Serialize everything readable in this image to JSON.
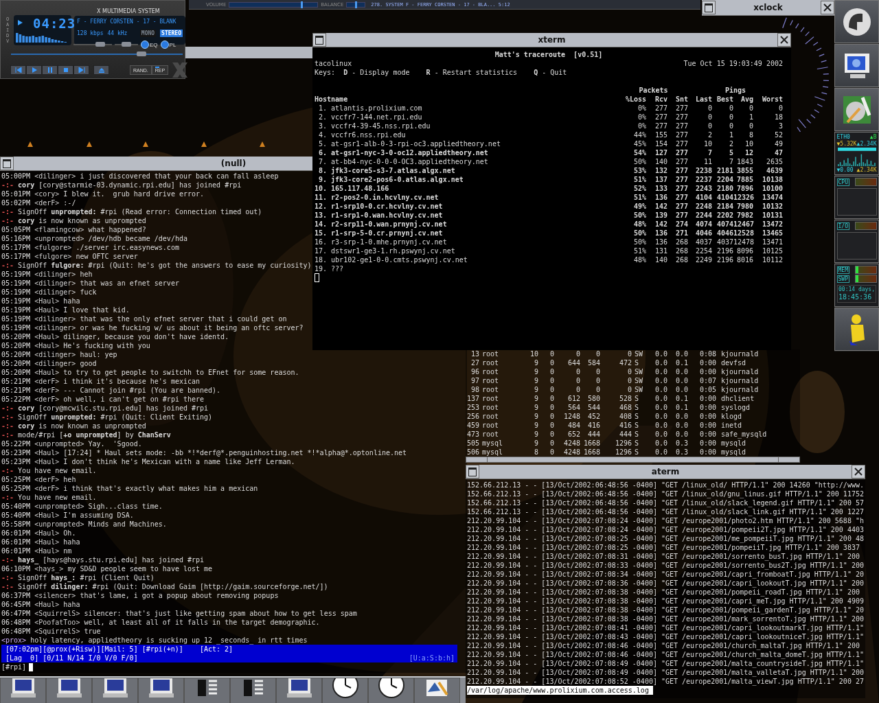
{
  "player": {
    "title": "X MULTIMEDIA SYSTEM",
    "side_letters": "OAIDV",
    "time": "04:23",
    "song": "F - FERRY CORSTEN - 17 - BLANK",
    "bitrate": "128 kbps",
    "samplerate": "44 kHz",
    "channel_modes": [
      {
        "label": "MONO",
        "selected": false
      },
      {
        "label": "STEREO",
        "selected": true
      }
    ],
    "volume": {
      "level": 0.7
    },
    "balance": {
      "level": 0.5
    },
    "position": {
      "level": 0.76
    },
    "toggles": [
      {
        "label": "EQ",
        "on": true
      },
      {
        "label": "PL",
        "on": true
      }
    ],
    "modes": [
      {
        "label": "RAND.",
        "on": false
      },
      {
        "label": "REP",
        "on": true
      }
    ]
  },
  "topbar": {
    "volume": {
      "label": "VOLUME",
      "level": 0.82
    },
    "balance": {
      "label": "BALANCE",
      "level": 0.5
    },
    "track": "278. SYSTEM F - FERRY CORSTEN - 17 - BLA...  5:12"
  },
  "xclock": {
    "title": "xclock"
  },
  "irc": {
    "title": "(null)",
    "lines": [
      {
        "kind": "msg",
        "time": "05:00PM",
        "nick": "<dilinger>",
        "text": "i just discovered that your back can fall asleep"
      },
      {
        "kind": "event",
        "prefix": "-:-",
        "text": "**cory** [cory@starmie-03.dynamic.rpi.edu] has joined #rpi"
      },
      {
        "kind": "msg",
        "time": "05:01PM",
        "nick": "<cory>",
        "text": "I blew it.  grub hard drive error."
      },
      {
        "kind": "msg",
        "time": "05:02PM",
        "nick": "<derF>",
        "text": ":-/"
      },
      {
        "kind": "event",
        "prefix": "-:-",
        "text": "SignOff **unprompted:** #rpi (Read error: Connection timed out)"
      },
      {
        "kind": "event",
        "prefix": "-:-",
        "text": "**cory** is now known as unprompted"
      },
      {
        "kind": "msg",
        "time": "05:05PM",
        "nick": "<flamingcow>",
        "text": "what happened?"
      },
      {
        "kind": "msg",
        "time": "05:16PM",
        "nick": "<unprompted>",
        "text": "/dev/hdb became /dev/hda"
      },
      {
        "kind": "msg",
        "time": "05:17PM",
        "nick": "<fulgore>",
        "text": "./server irc.easynews.com"
      },
      {
        "kind": "msg",
        "time": "05:17PM",
        "nick": "<fulgore>",
        "text": "new OFTC server"
      },
      {
        "kind": "event",
        "prefix": "-:-",
        "text": "SignOff **fulgore:** #rpi (Quit: he's got the answers to ease my curiosity)"
      },
      {
        "kind": "msg",
        "time": "05:19PM",
        "nick": "<dilinger>",
        "text": "heh"
      },
      {
        "kind": "msg",
        "time": "05:19PM",
        "nick": "<dilinger>",
        "text": "that was an efnet server"
      },
      {
        "kind": "msg",
        "time": "05:19PM",
        "nick": "<dilinger>",
        "text": "fuck"
      },
      {
        "kind": "msg",
        "time": "05:19PM",
        "nick": "<Haul>",
        "text": "haha"
      },
      {
        "kind": "msg",
        "time": "05:19PM",
        "nick": "<Haul>",
        "text": "I love that kid."
      },
      {
        "kind": "msg",
        "time": "05:19PM",
        "nick": "<dilinger>",
        "text": "that was the only efnet server that i could get on"
      },
      {
        "kind": "msg",
        "time": "05:19PM",
        "nick": "<dilinger>",
        "text": "or was he fucking w/ us about it being an oftc server?"
      },
      {
        "kind": "msg",
        "time": "05:20PM",
        "nick": "<Haul>",
        "text": "dilinger, because you don't have identd."
      },
      {
        "kind": "msg",
        "time": "05:20PM",
        "nick": "<Haul>",
        "text": "He's fucking with you"
      },
      {
        "kind": "msg",
        "time": "05:20PM",
        "nick": "<dilinger>",
        "text": "haul: yep"
      },
      {
        "kind": "msg",
        "time": "05:20PM",
        "nick": "<dilinger>",
        "text": "good"
      },
      {
        "kind": "msg",
        "time": "05:20PM",
        "nick": "<Haul>",
        "text": "to try to get people to switchh to EFnet for some reason."
      },
      {
        "kind": "msg",
        "time": "05:21PM",
        "nick": "<derF>",
        "text": "i think it's because he's mexican"
      },
      {
        "kind": "msg",
        "time": "05:21PM",
        "nick": "<derF>",
        "text": "--- Cannot join #rpi (You are banned)."
      },
      {
        "kind": "msg",
        "time": "05:22PM",
        "nick": "<derF>",
        "text": "oh well, i can't get on #rpi there"
      },
      {
        "kind": "event",
        "prefix": "-:-",
        "text": "**cory** [cory@mcwilc.stu.rpi.edu] has joined #rpi"
      },
      {
        "kind": "event",
        "prefix": "-:-",
        "text": "SignOff **unprompted:** #rpi (Quit: Client Exiting)"
      },
      {
        "kind": "event",
        "prefix": "-:-",
        "text": "**cory** is now known as unprompted"
      },
      {
        "kind": "event",
        "prefix": "-:-",
        "text": "mode/#rpi [**+o unprompted**] by **ChanServ**"
      },
      {
        "kind": "msg",
        "time": "05:22PM",
        "nick": "<unprompted>",
        "text": "Yay.  'Sgood."
      },
      {
        "kind": "msg",
        "time": "05:23PM",
        "nick": "<Haul>",
        "text": "[17:24] * Haul sets mode: -bb *!*derf@*.penguinhosting.net *!*alpha@*.optonline.net"
      },
      {
        "kind": "msg",
        "time": "05:23PM",
        "nick": "<Haul>",
        "text": "I don't think he's Mexican with a name like Jeff Lerman."
      },
      {
        "kind": "event",
        "prefix": "-:-",
        "text": "You have new email."
      },
      {
        "kind": "msg",
        "time": "05:25PM",
        "nick": "<derF>",
        "text": "heh"
      },
      {
        "kind": "msg",
        "time": "05:25PM",
        "nick": "<derF>",
        "text": "i think that's exactly what makes him a mexican"
      },
      {
        "kind": "event",
        "prefix": "-:-",
        "text": "You have new email."
      },
      {
        "kind": "msg",
        "time": "05:40PM",
        "nick": "<unprompted>",
        "text": "Sigh...class time."
      },
      {
        "kind": "msg",
        "time": "05:40PM",
        "nick": "<Haul>",
        "text": "I'm assuming DSA."
      },
      {
        "kind": "msg",
        "time": "05:58PM",
        "nick": "<unprompted>",
        "text": "Minds and Machines."
      },
      {
        "kind": "msg",
        "time": "06:01PM",
        "nick": "<Haul>",
        "text": "Oh."
      },
      {
        "kind": "msg",
        "time": "06:01PM",
        "nick": "<Haul>",
        "text": "haha"
      },
      {
        "kind": "msg",
        "time": "06:01PM",
        "nick": "<Haul>",
        "text": "nm"
      },
      {
        "kind": "event",
        "prefix": "-:-",
        "text": "**hays_** [hays@hays.stu.rpi.edu] has joined #rpi"
      },
      {
        "kind": "msg",
        "time": "06:10PM",
        "nick": "<hays_>",
        "text": "my SD&D people seem to have lost me"
      },
      {
        "kind": "event",
        "prefix": "-:-",
        "text": "SignOff **hays_:** #rpi (Client Quit)"
      },
      {
        "kind": "event",
        "prefix": "-:-",
        "text": "SignOff **dilinger:** #rpi (Quit: Download Gaim [http://gaim.sourceforge.net/])"
      },
      {
        "kind": "msg",
        "time": "06:37PM",
        "nick": "<silencer>",
        "text": "that's lame, i got a popup about removing popups"
      },
      {
        "kind": "msg",
        "time": "06:45PM",
        "nick": "<Haul>",
        "text": "haha"
      },
      {
        "kind": "msg",
        "time": "06:47PM",
        "nick": "<SquirrelS>",
        "text": "silencer: that's just like getting spam about how to get less spam"
      },
      {
        "kind": "msg",
        "time": "06:48PM",
        "nick": "<PoofatToo>",
        "text": "well, at least all of it falls in the target demographic."
      },
      {
        "kind": "msg",
        "time": "06:48PM",
        "nick": "<SquirrelS>",
        "text": "true"
      },
      {
        "kind": "own",
        "nick": "<prox>",
        "text": "holy latency, appliedtheory is sucking up 12 _seconds_ in rtt times"
      }
    ],
    "status_1": "[07:02pm][@prox(+Risw)][Mail: 5] [#rpi(+n)]    [Act: 2]",
    "status_2": "[Lag  0] [0/11 N/14 I/0 V/0 F/0]",
    "status_2_right": "[U:a:S:b:h]",
    "prompt": "[#rpi]"
  },
  "xterm": {
    "title": "xterm",
    "heading": "Matt's traceroute  [v0.51]",
    "host": "tacolinux",
    "date": "Tue Oct 15 19:03:49 2002",
    "keys": "Keys:  **D** - Display mode    **R** - Restart statistics    **Q** - Quit",
    "groups": [
      "Packets",
      "Pings"
    ],
    "columns": [
      "Hostname",
      "%Loss",
      "Rcv",
      "Snt",
      "Last",
      "Best",
      "Avg",
      "Worst"
    ],
    "rows": [
      {
        "n": "1.",
        "host": "atlantis.prolixium.com",
        "bold": false,
        "stats": [
          "0%",
          "277",
          "277",
          "0",
          "0",
          "0",
          "0"
        ]
      },
      {
        "n": "2.",
        "host": "vccfr7-144.net.rpi.edu",
        "bold": false,
        "stats": [
          "0%",
          "277",
          "277",
          "0",
          "0",
          "1",
          "18"
        ]
      },
      {
        "n": "3.",
        "host": "vccfr4-39-45.nss.rpi.edu",
        "bold": false,
        "stats": [
          "0%",
          "277",
          "277",
          "0",
          "0",
          "0",
          "3"
        ]
      },
      {
        "n": "4.",
        "host": "vccfr6.nss.rpi.edu",
        "bold": false,
        "stats": [
          "44%",
          "155",
          "277",
          "2",
          "1",
          "8",
          "52"
        ]
      },
      {
        "n": "5.",
        "host": "at-gsr1-alb-0-3-rpi-oc3.appliedtheory.net",
        "bold": false,
        "stats": [
          "45%",
          "154",
          "277",
          "10",
          "2",
          "10",
          "49"
        ]
      },
      {
        "n": "6.",
        "host": "at-gsr1-nyc-3-0-oc12.appliedtheory.net",
        "bold": true,
        "stats": [
          "54%",
          "127",
          "277",
          "7",
          "5",
          "12",
          "47"
        ]
      },
      {
        "n": "7.",
        "host": "at-bb4-nyc-0-0-0-OC3.appliedtheory.net",
        "bold": false,
        "stats": [
          "50%",
          "140",
          "277",
          "11",
          "7",
          "1843",
          "2635"
        ]
      },
      {
        "n": "8.",
        "host": "jfk3-core5-s3-7.atlas.algx.net",
        "bold": true,
        "stats": [
          "53%",
          "132",
          "277",
          "2238",
          "2181",
          "3855",
          "4639"
        ]
      },
      {
        "n": "9.",
        "host": "jfk3-core2-pos6-0.atlas.algx.net",
        "bold": true,
        "stats": [
          "51%",
          "137",
          "277",
          "2237",
          "2204",
          "7885",
          "10138"
        ]
      },
      {
        "n": "10.",
        "host": "165.117.48.166",
        "bold": true,
        "stats": [
          "52%",
          "133",
          "277",
          "2243",
          "2180",
          "7896",
          "10100"
        ]
      },
      {
        "n": "11.",
        "host": "r2-pos2-0.in.hcvlny.cv.net",
        "bold": true,
        "stats": [
          "51%",
          "136",
          "277",
          "4104",
          "4104",
          "12326",
          "13474"
        ]
      },
      {
        "n": "12.",
        "host": "r1-srp10-0.cr.hcvlny.cv.net",
        "bold": true,
        "stats": [
          "49%",
          "142",
          "277",
          "2248",
          "2184",
          "7980",
          "10132"
        ]
      },
      {
        "n": "13.",
        "host": "r1-srp1-0.wan.hcvlny.cv.net",
        "bold": true,
        "stats": [
          "50%",
          "139",
          "277",
          "2244",
          "2202",
          "7982",
          "10131"
        ]
      },
      {
        "n": "14.",
        "host": "r2-srp11-0.wan.prnynj.cv.net",
        "bold": true,
        "stats": [
          "48%",
          "142",
          "274",
          "4074",
          "4074",
          "12467",
          "13472"
        ]
      },
      {
        "n": "15.",
        "host": "r1-srp-5-0.cr.prnynj.cv.net",
        "bold": true,
        "stats": [
          "50%",
          "136",
          "271",
          "4046",
          "4046",
          "12528",
          "13465"
        ]
      },
      {
        "n": "16.",
        "host": "r3-srp-1-0.mhe.prnynj.cv.net",
        "bold": false,
        "stats": [
          "50%",
          "136",
          "268",
          "4037",
          "4037",
          "12478",
          "13471"
        ]
      },
      {
        "n": "17.",
        "host": "dstswr1-ge3-1.rh.pswynj.cv.net",
        "bold": false,
        "stats": [
          "51%",
          "131",
          "268",
          "2254",
          "2196",
          "8096",
          "10125"
        ]
      },
      {
        "n": "18.",
        "host": "ubr102-ge1-0-0.cmts.pswynj.cv.net",
        "bold": false,
        "stats": [
          "48%",
          "140",
          "268",
          "2249",
          "2196",
          "8016",
          "10112"
        ]
      },
      {
        "n": "19.",
        "host": "???",
        "bold": false,
        "stats": []
      }
    ]
  },
  "processes": [
    [
      "13",
      "root",
      "10",
      "0",
      "0",
      "0",
      "0",
      "SW",
      "0.0",
      "0.0",
      "0:08",
      "kjournald"
    ],
    [
      "27",
      "root",
      "9",
      "0",
      "644",
      "584",
      "472",
      "S",
      "0.0",
      "0.1",
      "0:00",
      "devfsd"
    ],
    [
      "96",
      "root",
      "9",
      "0",
      "0",
      "0",
      "0",
      "SW",
      "0.0",
      "0.0",
      "0:00",
      "kjournald"
    ],
    [
      "97",
      "root",
      "9",
      "0",
      "0",
      "0",
      "0",
      "SW",
      "0.0",
      "0.0",
      "0:07",
      "kjournald"
    ],
    [
      "98",
      "root",
      "9",
      "0",
      "0",
      "0",
      "0",
      "SW",
      "0.0",
      "0.0",
      "0:05",
      "kjournald"
    ],
    [
      "137",
      "root",
      "9",
      "0",
      "612",
      "580",
      "528",
      "S",
      "0.0",
      "0.1",
      "0:00",
      "dhclient"
    ],
    [
      "253",
      "root",
      "9",
      "0",
      "564",
      "544",
      "468",
      "S",
      "0.0",
      "0.1",
      "0:00",
      "syslogd"
    ],
    [
      "256",
      "root",
      "9",
      "0",
      "1248",
      "452",
      "408",
      "S",
      "0.0",
      "0.0",
      "0:00",
      "klogd"
    ],
    [
      "459",
      "root",
      "9",
      "0",
      "484",
      "416",
      "416",
      "S",
      "0.0",
      "0.0",
      "0:00",
      "inetd"
    ],
    [
      "473",
      "root",
      "9",
      "0",
      "652",
      "444",
      "444",
      "S",
      "0.0",
      "0.0",
      "0:00",
      "safe_mysqld"
    ],
    [
      "505",
      "mysql",
      "9",
      "0",
      "4248",
      "1668",
      "1296",
      "S",
      "0.0",
      "0.3",
      "0:00",
      "mysqld"
    ],
    [
      "506",
      "mysql",
      "8",
      "0",
      "4248",
      "1668",
      "1296",
      "S",
      "0.0",
      "0.3",
      "0:00",
      "mysqld"
    ]
  ],
  "aterm": {
    "title": "aterm",
    "lines": [
      "152.66.212.13 - - [13/Oct/2002:06:48:56 -0400] \"GET /linux_old/ HTTP/1.1\" 200 14260 \"http://www.",
      "152.66.212.13 - - [13/Oct/2002:06:48:56 -0400] \"GET /linux_old/gnu_linus.gif HTTP/1.1\" 200 11752",
      "152.66.212.13 - - [13/Oct/2002:06:48:56 -0400] \"GET /linux_old/slack_legend.gif HTTP/1.1\" 200 57",
      "152.66.212.13 - - [13/Oct/2002:06:48:56 -0400] \"GET /linux_old/slack_link.gif HTTP/1.1\" 200 1227",
      "212.20.99.104 - - [13/Oct/2002:07:08:24 -0400] \"GET /europe2001/photo2.htm HTTP/1.1\" 200 5688 \"h",
      "212.20.99.104 - - [13/Oct/2002:07:08:24 -0400] \"GET /europe2001/pompeii2T.jpg HTTP/1.1\" 200 4403",
      "212.20.99.104 - - [13/Oct/2002:07:08:25 -0400] \"GET /europe2001/me_pompeiiT.jpg HTTP/1.1\" 200 48",
      "212.20.99.104 - - [13/Oct/2002:07:08:25 -0400] \"GET /europe2001/pompeiiT.jpg HTTP/1.1\" 200 3837",
      "212.20.99.104 - - [13/Oct/2002:07:08:31 -0400] \"GET /europe2001/sorrento_busT.jpg HTTP/1.1\" 200",
      "212.20.99.104 - - [13/Oct/2002:07:08:33 -0400] \"GET /europe2001/sorrento_bus2T.jpg HTTP/1.1\" 200",
      "212.20.99.104 - - [13/Oct/2002:07:08:34 -0400] \"GET /europe2001/capri_fromboatT.jpg HTTP/1.1\" 20",
      "212.20.99.104 - - [13/Oct/2002:07:08:36 -0400] \"GET /europe2001/capri_lookoutT.jpg HTTP/1.1\" 200",
      "212.20.99.104 - - [13/Oct/2002:07:08:38 -0400] \"GET /europe2001/pompeii_roadT.jpg HTTP/1.1\" 200",
      "212.20.99.104 - - [13/Oct/2002:07:08:38 -0400] \"GET /europe2001/capri_meT.jpg HTTP/1.1\" 200 4909",
      "212.20.99.104 - - [13/Oct/2002:07:08:38 -0400] \"GET /europe2001/pompeii_gardenT.jpg HTTP/1.1\" 20",
      "212.20.99.104 - - [13/Oct/2002:07:08:38 -0400] \"GET /europe2001/mark_sorrentoT.jpg HTTP/1.1\" 200",
      "212.20.99.104 - - [13/Oct/2002:07:08:41 -0400] \"GET /europe2001/capri_lookoutmarkT.jpg HTTP/1.1\"",
      "212.20.99.104 - - [13/Oct/2002:07:08:43 -0400] \"GET /europe2001/capri_lookoutniceT.jpg HTTP/1.1\"",
      "212.20.99.104 - - [13/Oct/2002:07:08:46 -0400] \"GET /europe2001/church_maltaT.jpg HTTP/1.1\" 200",
      "212.20.99.104 - - [13/Oct/2002:07:08:46 -0400] \"GET /europe2001/church_malta_domeT.jpg HTTP/1.1\"",
      "212.20.99.104 - - [13/Oct/2002:07:08:49 -0400] \"GET /europe2001/malta_countrysideT.jpg HTTP/1.1\"",
      "212.20.99.104 - - [13/Oct/2002:07:08:49 -0400] \"GET /europe2001/malta_valletaT.jpg HTTP/1.1\" 200",
      "212.20.99.104 - - [13/Oct/2002:07:08:52 -0400] \"GET /europe2001/malta_viewT.jpg HTTP/1.1\" 200 27"
    ],
    "prompt": "/var/log/apache/www.prolixium.com.access.log"
  },
  "dock": {
    "net": {
      "iface": "ETH0",
      "extra": "▲B",
      "down": "▼5.32K",
      "up": "▲2.34K",
      "down_total": "▼0.00",
      "up_total": "▲2.34K"
    },
    "cpu": "CPU",
    "io": "I/O",
    "meters": [
      {
        "label": "MEM",
        "level": 0.15
      },
      {
        "label": "SWP",
        "level": 0.15
      }
    ],
    "uptime": "00:14 days,",
    "clock": "18:45:36"
  }
}
